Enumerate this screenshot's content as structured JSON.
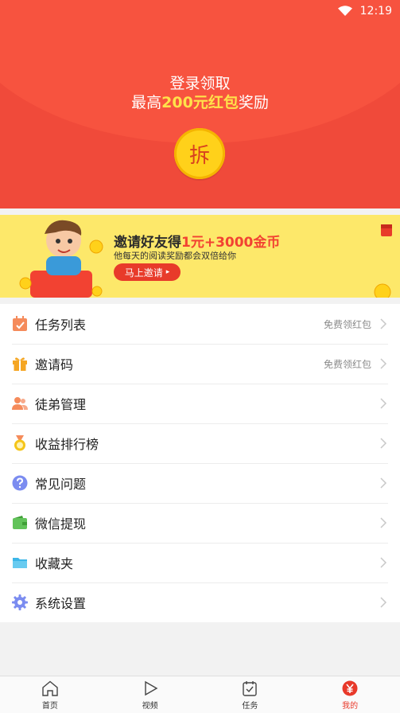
{
  "status_bar": {
    "time": "12:19"
  },
  "header": {
    "line1": "登录领取",
    "line2_prefix": "最高",
    "line2_highlight": "200元红包",
    "line2_suffix": "奖励",
    "open_button": "拆"
  },
  "banner": {
    "headline_prefix": "邀请好友得",
    "headline_highlight": "1元+3000金币",
    "subtitle": "他每天的阅读奖励都会双倍给你",
    "button": "马上邀请"
  },
  "menu": {
    "items": [
      {
        "label": "任务列表",
        "hint": "免费领红包",
        "icon": "calendar-icon",
        "color": "#f58b5b"
      },
      {
        "label": "邀请码",
        "hint": "免费领红包",
        "icon": "gift-icon",
        "color": "#f5a623"
      },
      {
        "label": "徒弟管理",
        "hint": "",
        "icon": "users-icon",
        "color": "#f58b5b"
      },
      {
        "label": "收益排行榜",
        "hint": "",
        "icon": "medal-icon",
        "color": "#f5c518"
      },
      {
        "label": "常见问题",
        "hint": "",
        "icon": "question-icon",
        "color": "#7b8cf0"
      },
      {
        "label": "微信提现",
        "hint": "",
        "icon": "wallet-icon",
        "color": "#62c35a"
      },
      {
        "label": "收藏夹",
        "hint": "",
        "icon": "folder-icon",
        "color": "#3cb6e8"
      },
      {
        "label": "系统设置",
        "hint": "",
        "icon": "gear-icon",
        "color": "#7b8cf0"
      }
    ]
  },
  "tabbar": {
    "tabs": [
      {
        "label": "首页",
        "icon": "home-icon"
      },
      {
        "label": "视频",
        "icon": "play-icon"
      },
      {
        "label": "任务",
        "icon": "task-icon"
      },
      {
        "label": "我的",
        "icon": "yuan-icon",
        "active": true
      }
    ]
  },
  "colors": {
    "accent": "#e8392a",
    "banner_bg": "#fde86a",
    "header_bg": "#f04a3a"
  }
}
